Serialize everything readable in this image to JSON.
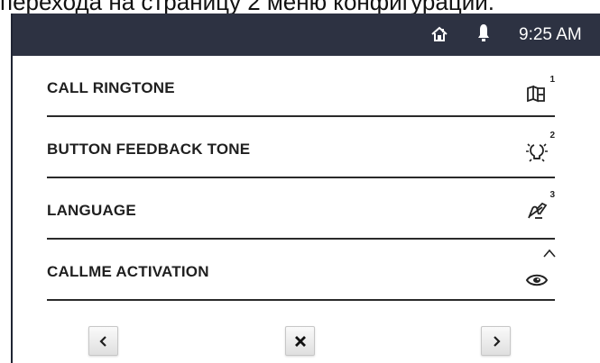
{
  "header_text": "перехода на страницу 2 меню конфигурации.",
  "status_bar": {
    "time": "9:25 AM",
    "icons": [
      "home-icon",
      "bell-icon"
    ]
  },
  "menu": {
    "items": [
      {
        "label": "CALL RINGTONE",
        "icon": "book-icon",
        "badge": "1"
      },
      {
        "label": "BUTTON FEEDBACK TONE",
        "icon": "lightbulb-icon",
        "badge": "2"
      },
      {
        "label": "LANGUAGE",
        "icon": "language-icon",
        "badge": "3"
      },
      {
        "label": "CALLME ACTIVATION",
        "icon": "eye-icon",
        "badge": ""
      }
    ]
  },
  "navigation": {
    "prev_icon": "chevron-left-icon",
    "close_icon": "close-icon",
    "next_icon": "chevron-right-icon"
  },
  "colors": {
    "status_bar": "#2d3242",
    "divider": "#2a2a2a",
    "text": "#1f1f1f"
  }
}
